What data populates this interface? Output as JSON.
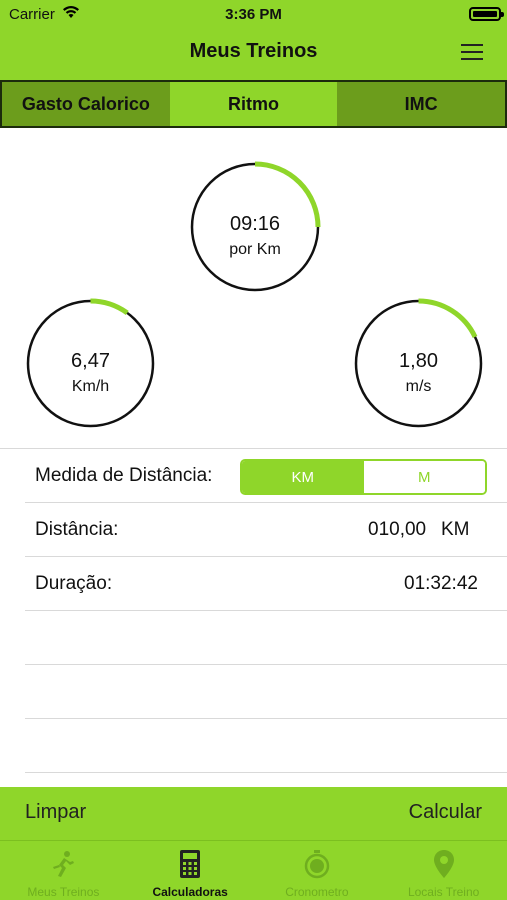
{
  "status_bar": {
    "carrier": "Carrier",
    "time": "3:36 PM"
  },
  "nav": {
    "title": "Meus Treinos",
    "menu_icon": "hamburger-menu-icon"
  },
  "tabs": [
    {
      "label": "Gasto Calorico",
      "active": false
    },
    {
      "label": "Ritmo",
      "active": true
    },
    {
      "label": "IMC",
      "active": false
    }
  ],
  "gauges": {
    "pace": {
      "value": "09:16",
      "unit": "por Km",
      "progress": 0.25
    },
    "speed_kmh": {
      "value": "6,47",
      "unit": "Km/h",
      "progress": 0.1
    },
    "speed_ms": {
      "value": "1,80",
      "unit": "m/s",
      "progress": 0.18
    }
  },
  "form": {
    "distance_unit_label": "Medida de Distância:",
    "unit_options": [
      "KM",
      "M"
    ],
    "selected_unit": "KM",
    "distance_label": "Distância:",
    "distance_value": "010,00",
    "distance_unit": "KM",
    "duration_label": "Duração:",
    "duration_value": "01:32:42"
  },
  "actions": {
    "clear": "Limpar",
    "calculate": "Calcular"
  },
  "tabbar": [
    {
      "label": "Meus Treinos",
      "icon": "runner-icon",
      "active": false
    },
    {
      "label": "Calculadoras",
      "icon": "calculator-icon",
      "active": true
    },
    {
      "label": "Cronometro",
      "icon": "stopwatch-icon",
      "active": false
    },
    {
      "label": "Locais Treino",
      "icon": "map-pin-icon",
      "active": false
    }
  ],
  "colors": {
    "accent": "#8fd62a",
    "tab_inactive": "#6c9d1c",
    "text": "#111111"
  }
}
